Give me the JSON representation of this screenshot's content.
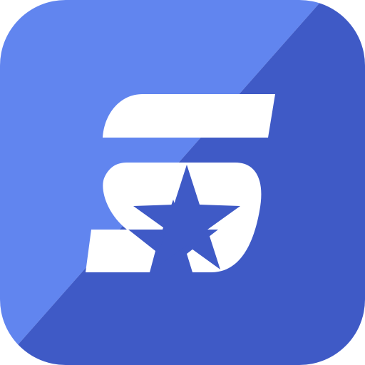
{
  "icon": {
    "name": "app-icon",
    "glyph": "s-star-logo-icon",
    "colors": {
      "light_blue": "#6185ef",
      "dark_blue": "#3f5ac6",
      "logo": "#ffffff"
    }
  }
}
